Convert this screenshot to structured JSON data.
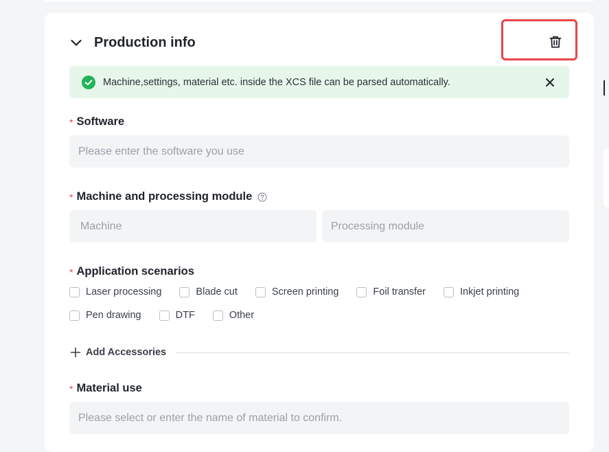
{
  "section": {
    "title": "Production info"
  },
  "alert": {
    "message": "Machine,settings, material etc. inside the XCS file can be parsed automatically."
  },
  "fields": {
    "software": {
      "required_mark": "*",
      "label": "Software",
      "placeholder": "Please enter the software you use"
    },
    "machine_module": {
      "required_mark": "*",
      "label": "Machine and processing module",
      "machine_placeholder": "Machine",
      "module_placeholder": "Processing module"
    },
    "application": {
      "required_mark": "*",
      "label": "Application scenarios",
      "options": [
        "Laser processing",
        "Blade cut",
        "Screen printing",
        "Foil transfer",
        "Inkjet printing",
        "Pen drawing",
        "DTF",
        "Other"
      ]
    },
    "accessories": {
      "label": "Add Accessories"
    },
    "material": {
      "required_mark": "*",
      "label": "Material use",
      "placeholder": "Please select or enter the name of material to confirm."
    }
  },
  "icons": {
    "collapse": "chevron-down-icon",
    "delete": "trash-icon",
    "success": "check-circle-icon",
    "close": "close-icon",
    "help": "question-circle-icon",
    "add": "plus-icon"
  },
  "colors": {
    "required": "#e8444a",
    "success": "#22b35a",
    "alert_bg": "#e7f6ea",
    "highlight": "#e8444a",
    "input_bg": "#f3f4f6"
  }
}
